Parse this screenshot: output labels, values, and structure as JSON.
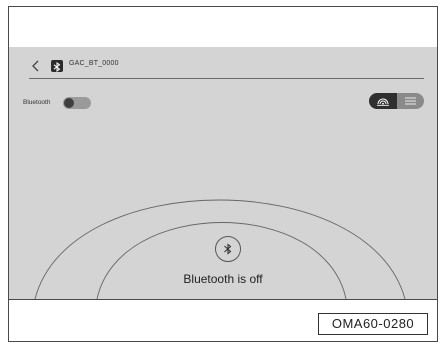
{
  "topbar": {
    "device_name": "GAC_BT_0000"
  },
  "bluetooth": {
    "label": "Bluetooth",
    "enabled": false
  },
  "view_toggle": {
    "options": [
      "radar-icon",
      "list-icon"
    ],
    "selected": "radar-icon"
  },
  "status": {
    "text": "Bluetooth is off"
  },
  "figure": {
    "code": "OMA60-0280"
  },
  "colors": {
    "screen_bg": "#d4d4d4",
    "segment_active": "#2f2f2f",
    "segment_inactive": "#8a8a8a"
  }
}
